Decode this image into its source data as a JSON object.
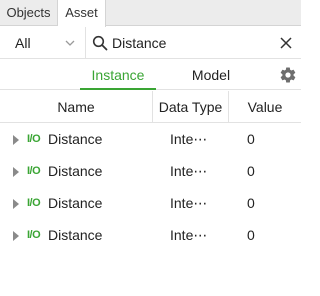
{
  "top_tabs": [
    {
      "label": "Objects"
    },
    {
      "label": "Asset"
    }
  ],
  "filter": {
    "scope_value": "All",
    "search_value": "Distance"
  },
  "view_tabs": [
    {
      "label": "Instance",
      "active": true
    },
    {
      "label": "Model",
      "active": false
    }
  ],
  "grid": {
    "columns": [
      "Name",
      "Data Type",
      "Value"
    ],
    "rows": [
      {
        "badge": "I/O",
        "name": "Distance",
        "type": "Inte⋯",
        "value": "0"
      },
      {
        "badge": "I/O",
        "name": "Distance",
        "type": "Inte⋯",
        "value": "0"
      },
      {
        "badge": "I/O",
        "name": "Distance",
        "type": "Inte⋯",
        "value": "0"
      },
      {
        "badge": "I/O",
        "name": "Distance",
        "type": "Inte⋯",
        "value": "0"
      }
    ]
  },
  "colors": {
    "accent": "#3aa534",
    "text": "#222222",
    "tabbar_bg": "#ececec"
  },
  "icons": {
    "scope_dropdown": "chevron-down-icon",
    "search": "search-icon",
    "clear": "close-icon",
    "settings": "gear-icon",
    "row_expand": "caret-right-icon",
    "row_badge": "io-icon"
  }
}
